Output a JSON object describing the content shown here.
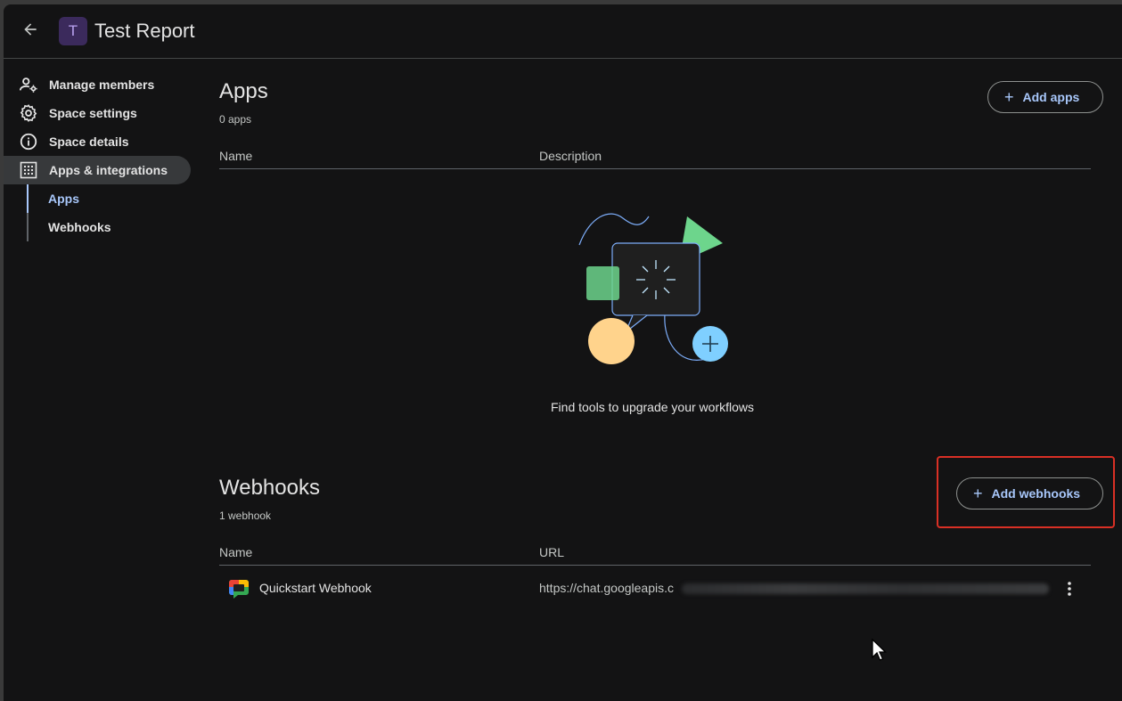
{
  "header": {
    "back_icon": "arrow-back-icon",
    "avatar_letter": "T",
    "title": "Test Report"
  },
  "sidebar": {
    "items": [
      {
        "label": "Manage members",
        "icon": "manage-members-icon"
      },
      {
        "label": "Space settings",
        "icon": "gear-icon"
      },
      {
        "label": "Space details",
        "icon": "info-icon"
      },
      {
        "label": "Apps & integrations",
        "icon": "apps-grid-icon"
      }
    ],
    "sub_items": [
      {
        "label": "Apps",
        "selected": true
      },
      {
        "label": "Webhooks",
        "selected": false
      }
    ]
  },
  "apps": {
    "title": "Apps",
    "count": "0 apps",
    "add_label": "Add apps",
    "columns": [
      "Name",
      "Description"
    ],
    "empty_message": "Find tools to upgrade your workflows"
  },
  "webhooks": {
    "title": "Webhooks",
    "count": "1 webhook",
    "add_label": "Add webhooks",
    "columns": [
      "Name",
      "URL"
    ],
    "rows": [
      {
        "name": "Quickstart Webhook",
        "url": "https://chat.googleapis.c"
      }
    ]
  },
  "colors": {
    "accent": "#a8c7fa",
    "background": "#131314",
    "highlight": "#d93025"
  }
}
